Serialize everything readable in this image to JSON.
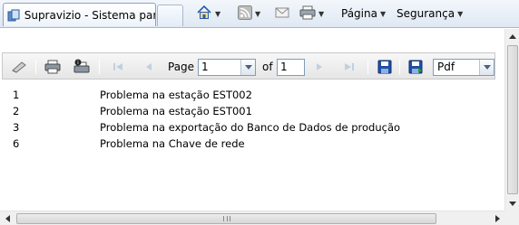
{
  "browser": {
    "tab_title": "Supravizio - Sistema par...",
    "menu_pagina": "Página",
    "menu_seguranca": "Segurança"
  },
  "toolbar": {
    "page_label": "Page",
    "page_value": "1",
    "of_label": "of",
    "total_pages": "1",
    "export_format": "Pdf"
  },
  "report": {
    "rows": [
      {
        "id": "1",
        "description": "Problema na estação EST002"
      },
      {
        "id": "2",
        "description": "Problema na estação EST001"
      },
      {
        "id": "3",
        "description": "Problema na exportação do Banco de Dados de produção"
      },
      {
        "id": "6",
        "description": "Problema na Chave de rede"
      }
    ]
  },
  "icons": {
    "home": "home-icon",
    "feeds": "feeds-icon",
    "mail": "mail-icon",
    "print": "print-icon"
  }
}
